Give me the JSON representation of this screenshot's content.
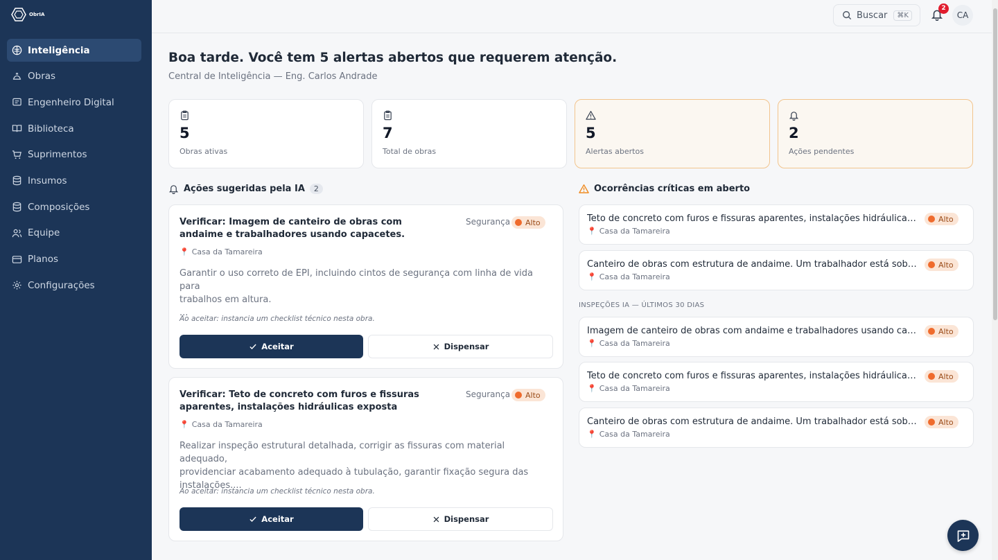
{
  "app": {
    "logo_text": "ObrIA"
  },
  "sidebar": {
    "items": [
      {
        "label": "Inteligência",
        "icon": "brain-icon",
        "active": true
      },
      {
        "label": "Obras",
        "icon": "helmet-icon"
      },
      {
        "label": "Engenheiro Digital",
        "icon": "message-icon"
      },
      {
        "label": "Biblioteca",
        "icon": "book-icon"
      },
      {
        "label": "Suprimentos",
        "icon": "cart-icon"
      },
      {
        "label": "Insumos",
        "icon": "database-icon"
      },
      {
        "label": "Composições",
        "icon": "database-icon"
      },
      {
        "label": "Equipe",
        "icon": "users-icon"
      },
      {
        "label": "Planos",
        "icon": "credit-card-icon"
      },
      {
        "label": "Configurações",
        "icon": "gear-icon"
      }
    ]
  },
  "topbar": {
    "search_label": "Buscar",
    "search_shortcut": "⌘K",
    "notification_count": "2",
    "avatar_initials": "CA"
  },
  "main": {
    "greeting": "Boa tarde. Você tem 5 alertas abertos que requerem atenção.",
    "subtitle": "Central de Inteligência — Eng. Carlos Andrade",
    "stats": [
      {
        "value": "5",
        "label": "Obras ativas",
        "icon": "clipboard-icon"
      },
      {
        "value": "7",
        "label": "Total de obras",
        "icon": "clipboard-icon"
      },
      {
        "value": "5",
        "label": "Alertas abertos",
        "icon": "warning-icon"
      },
      {
        "value": "2",
        "label": "Ações pendentes",
        "icon": "bell-icon"
      }
    ],
    "suggested": {
      "title": "Ações sugeridas pela IA",
      "count": "2",
      "cards": [
        {
          "title": "Verificar: Imagem de canteiro de obras com andaime e trabalhadores usando capacetes.",
          "category": "Segurança",
          "severity": "Alto",
          "location": "Casa da Tamareira",
          "description_lines": [
            "Garantir o uso correto de EPI, incluindo cintos de segurança com linha de vida para",
            "trabalhos em altura.",
            "..."
          ],
          "note": "Ao aceitar: instancia um checklist técnico nesta obra.",
          "accept_label": "Aceitar",
          "dismiss_label": "Dispensar"
        },
        {
          "title": "Verificar: Teto de concreto com furos e fissuras aparentes, instalações hidráulicas exposta",
          "category": "Segurança",
          "severity": "Alto",
          "location": "Casa da Tamareira",
          "description_lines": [
            "Realizar inspeção estrutural detalhada, corrigir as fissuras com material adequado,",
            "providenciar acabamento adequado à tubulação, garantir fixação segura das",
            "instalações...."
          ],
          "note": "Ao aceitar: instancia um checklist técnico nesta obra.",
          "accept_label": "Aceitar",
          "dismiss_label": "Dispensar"
        }
      ]
    },
    "critical": {
      "title": "Ocorrências críticas em aberto",
      "items": [
        {
          "title": "Teto de concreto com furos e fissuras aparentes, instalações hidráulicas ...",
          "location": "Casa da Tamareira",
          "severity": "Alto"
        },
        {
          "title": "Canteiro de obras com estrutura de andaime. Um trabalhador está sobre ...",
          "location": "Casa da Tamareira",
          "severity": "Alto"
        }
      ]
    },
    "inspections": {
      "title": "INSPEÇÕES IA — ÚLTIMOS 30 DIAS",
      "items": [
        {
          "title": "Imagem de canteiro de obras com andaime e trabalhadores usando capa...",
          "location": "Casa da Tamareira",
          "severity": "Alto"
        },
        {
          "title": "Teto de concreto com furos e fissuras aparentes, instalações hidráulicas ...",
          "location": "Casa da Tamareira",
          "severity": "Alto"
        },
        {
          "title": "Canteiro de obras com estrutura de andaime. Um trabalhador está sobre ...",
          "location": "Casa da Tamareira",
          "severity": "Alto"
        }
      ]
    }
  },
  "colors": {
    "sidebar_bg": "#1c3557",
    "accent": "#1c3557",
    "severity_high": "#ef6b2d",
    "warning": "#ef8a1f"
  }
}
